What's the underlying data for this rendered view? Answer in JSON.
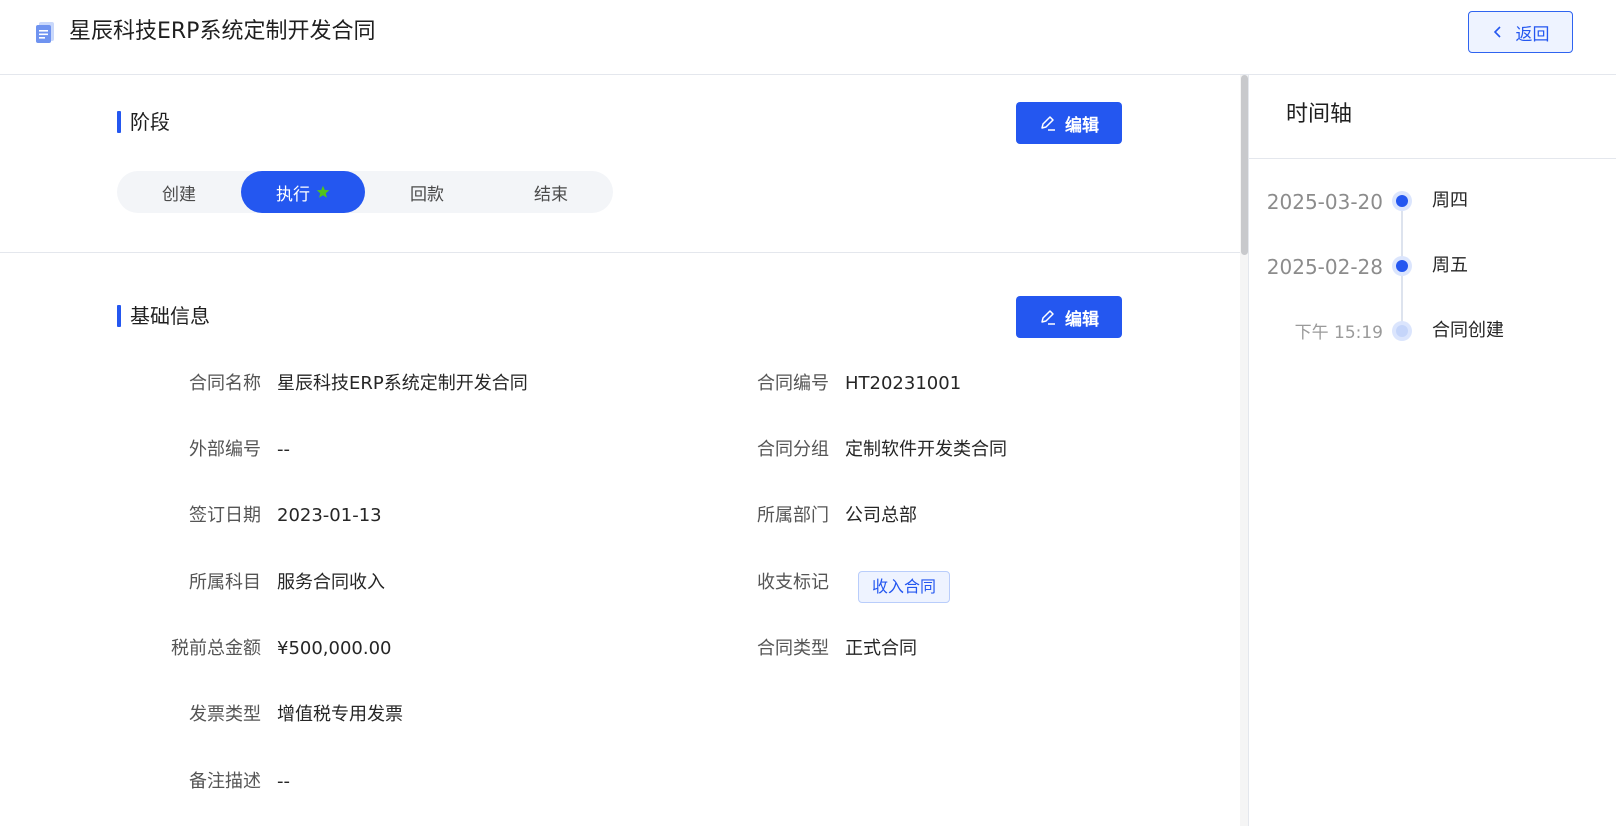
{
  "header": {
    "title": "星辰科技ERP系统定制开发合同",
    "back_label": "返回"
  },
  "stage_section": {
    "title": "阶段",
    "edit_label": "编辑",
    "stages": [
      {
        "label": "创建",
        "active": false
      },
      {
        "label": "执行",
        "active": true
      },
      {
        "label": "回款",
        "active": false
      },
      {
        "label": "结束",
        "active": false
      }
    ]
  },
  "basic_section": {
    "title": "基础信息",
    "edit_label": "编辑",
    "fields": {
      "contract_name": {
        "label": "合同名称",
        "value": "星辰科技ERP系统定制开发合同"
      },
      "contract_no": {
        "label": "合同编号",
        "value": "HT20231001"
      },
      "external_no": {
        "label": "外部编号",
        "value": "--"
      },
      "contract_group": {
        "label": "合同分组",
        "value": "定制软件开发类合同"
      },
      "sign_date": {
        "label": "签订日期",
        "value": "2023-01-13"
      },
      "department": {
        "label": "所属部门",
        "value": "公司总部"
      },
      "subject": {
        "label": "所属科目",
        "value": "服务合同收入"
      },
      "income_flag": {
        "label": "收支标记",
        "value": "收入合同"
      },
      "pretax_amount": {
        "label": "税前总金额",
        "value": "¥500,000.00"
      },
      "contract_type": {
        "label": "合同类型",
        "value": "正式合同"
      },
      "invoice_type": {
        "label": "发票类型",
        "value": "增值税专用发票"
      },
      "remark": {
        "label": "备注描述",
        "value": "--"
      }
    }
  },
  "timeline": {
    "title": "时间轴",
    "entries": [
      {
        "date": "2025-03-20",
        "text": "周四"
      },
      {
        "date": "2025-02-28",
        "text": "周五"
      },
      {
        "date": "下午 15:19",
        "text": "合同创建"
      }
    ]
  },
  "colors": {
    "primary": "#2457f0",
    "star": "#52c41a"
  }
}
